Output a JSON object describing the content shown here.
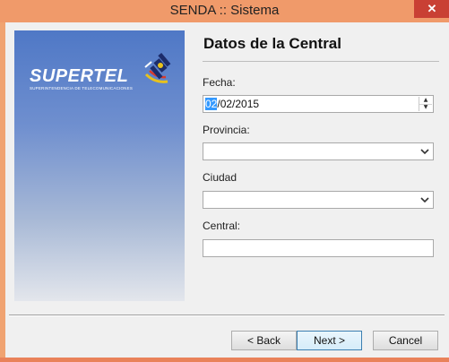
{
  "window": {
    "title": "SENDA :: Sistema",
    "close_label": "✕"
  },
  "banner": {
    "logo_text": "SUPERTEL",
    "logo_subtitle": "SUPERINTENDENCIA DE TELECOMUNICACIONES"
  },
  "form": {
    "heading": "Datos de la Central",
    "fecha_label": "Fecha:",
    "fecha_day": "02",
    "fecha_rest": "/02/2015",
    "provincia_label": "Provincia:",
    "provincia_value": "",
    "ciudad_label": "Ciudad",
    "ciudad_value": "",
    "central_label": "Central:",
    "central_value": ""
  },
  "buttons": {
    "back": "< Back",
    "next": "Next >",
    "cancel": "Cancel"
  },
  "icons": {
    "close": "close-icon",
    "spin_up": "spin-up-icon",
    "spin_down": "spin-down-icon",
    "dropdown": "chevron-down-icon",
    "satellite": "satellite-icon"
  }
}
